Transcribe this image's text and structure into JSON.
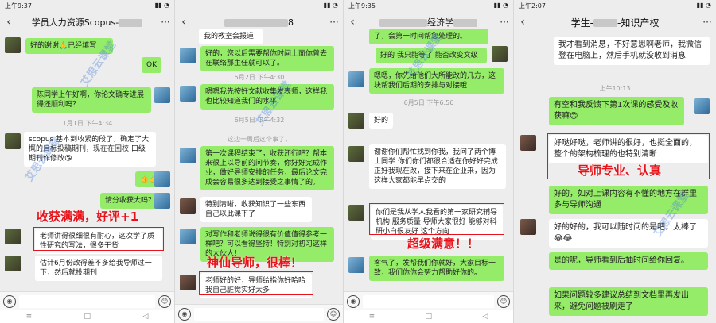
{
  "watermark": "艾思云课堂",
  "accent_red": "#e8121a",
  "panel1": {
    "status_time": "上午9:37",
    "title_prefix": "学员人力资源Scopus-",
    "messages": [
      {
        "text": "好的谢谢🙏已经填写"
      },
      {
        "text": "OK"
      },
      {
        "text": "陈同学上午好啊，你论文确专进展得还顺利吗？"
      },
      {
        "time": "1月1日 下午4:34"
      },
      {
        "text": "scopus 基本到收紧的段了，确定了大概的目标投稿期刊，现在在回校 口级期刊作修改😘"
      },
      {
        "text": "👍👍"
      },
      {
        "text": "请分收获大吗？"
      },
      {
        "text": "老师讲得很细很有耐心，这次学了质性研究的写法，很多干货"
      },
      {
        "text": "估计6月份改得差不多给我导师过一下，然后就投期刊"
      }
    ],
    "callout": "收获满满，好评+1"
  },
  "panel2": {
    "status_time": "",
    "title_suffix": "8",
    "messages": [
      {
        "text": "我的教室会报道"
      },
      {
        "text": "好的，您以后需要帮你时间上面你曾去在联络那主任就可以了。"
      },
      {
        "time": "5月2日 下午4:30"
      },
      {
        "text": "嗯嗯我先按好文献收集发表师，这样我也比较知道我们的水平"
      },
      {
        "time": "6月5日 下午4:32"
      },
      {
        "text": "这边一周后这个事了，"
      },
      {
        "text": "第一次课程结束了，收获还行吧？帮本来很上以导前的问节奏，你好好完成作业，做好导师安排的任务，最后论文完成会容易很多达到接受之事情了的。"
      },
      {
        "text": "特别清晰，收获知识了一些东西自己以此课下了"
      },
      {
        "text": "对写作和老师说得很有价值值得参考一样吧？可以看得坚持！特别对初习这样的大伙人！"
      },
      {
        "text": "老师好的好，导师给指你好哈哈我自己脏觉实好太多"
      }
    ],
    "callout": "神仙导师，很棒！"
  },
  "panel3": {
    "status_time": "上午9:35",
    "title_suffix": "经济学",
    "messages": [
      {
        "text": "了，会第一时间帮您处理的。"
      },
      {
        "text": "好的 我只能等了 能否改变文级"
      },
      {
        "text": "嗯嗯，你先给他们大所能改的几方，这块帮我们后期的安排与对接哦"
      },
      {
        "time": "6月5日 下午6:56"
      },
      {
        "text": "好的"
      },
      {
        "text": "谢谢你们帮忙找到你我，我问了两个博士同学 你们你们都很合适在你好好完成 正好我现在改，接下来在企业来，因为这样大家都能早点交的"
      },
      {
        "text": "你们是我从学人我看的第一家研究辅导机构 服务质量 导师大家很好 能够对科研小白很友好 这个方向"
      },
      {
        "text": "客气了，发帮我们你就好，大家目标一致，我们你你会努力帮助好你的。"
      }
    ],
    "callout": "超级满意！！"
  },
  "panel4": {
    "status_time": "上午2:07",
    "title_prefix": "学生-",
    "title_suffix": "-知识产权",
    "messages": [
      {
        "text": "我才看到消息，不好意思啊老师，我微信登在电脑上，然后手机就没收到消息"
      },
      {
        "time": "上午10:13"
      },
      {
        "text": "有空和我反馈下第1次课的感受及收获嘛😊"
      },
      {
        "text": "好哒好哒，老师讲的很好，也挺全面的，整个的架构梳理的也特别清晰"
      },
      {
        "text": "好的，如对上课内容有不懂的地方在群里多与导师沟通"
      },
      {
        "text": "好的好的，我可以随时问的是吧，太棒了😂😂"
      },
      {
        "text": "是的呢，导师看到后抽时间给你回复。"
      },
      {
        "text": "如果问题较多建议总结到文档里再发出来，避免问题被刷走了"
      }
    ],
    "callout": "导师专业、认真"
  }
}
